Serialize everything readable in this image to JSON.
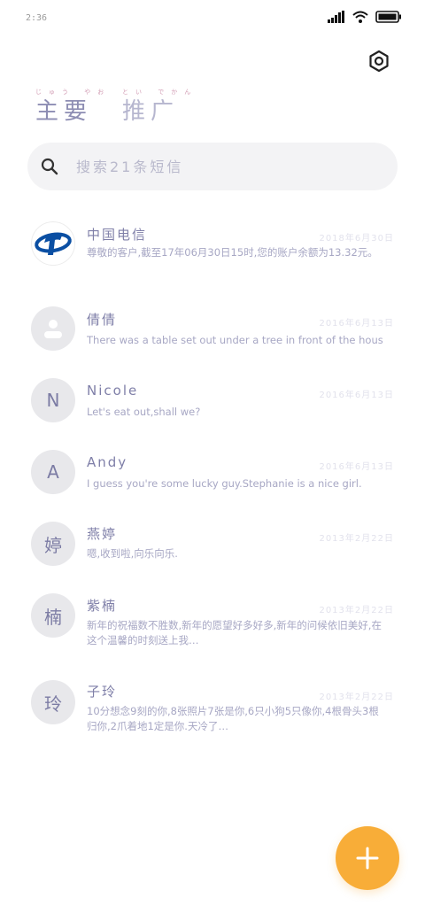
{
  "status_bar": {
    "time": "2:36"
  },
  "tabs": [
    {
      "label": "主要",
      "ruby": "じゅう やお"
    },
    {
      "label": "推广",
      "ruby": "とい でかん"
    }
  ],
  "search": {
    "placeholder": "搜索21条短信"
  },
  "conversations": [
    {
      "name": "中国电信",
      "avatar_text": "",
      "avatar_type": "brand",
      "date": "2018年6月30日",
      "snippet": "尊敬的客户,截至17年06月30日15时,您的账户余额为13.32元。"
    },
    {
      "name": "倩倩",
      "avatar_text": "",
      "avatar_type": "person",
      "date": "2016年6月13日",
      "snippet": "There was a table set out under a tree in front of the hous"
    },
    {
      "name": "Nicole",
      "avatar_text": "N",
      "avatar_type": "letter",
      "date": "2016年6月13日",
      "snippet": "Let's eat out,shall we?"
    },
    {
      "name": "Andy",
      "avatar_text": "A",
      "avatar_type": "letter",
      "date": "2016年6月13日",
      "snippet": "I guess you're some lucky guy.Stephanie is a nice girl."
    },
    {
      "name": "燕婷",
      "avatar_text": "婷",
      "avatar_type": "letter",
      "date": "2013年2月22日",
      "snippet": "嗯,收到啦,向乐向乐."
    },
    {
      "name": "紫楠",
      "avatar_text": "楠",
      "avatar_type": "letter",
      "date": "2013年2月22日",
      "snippet": "新年的祝福数不胜数,新年的愿望好多好多,新年的问候依旧美好,在这个温馨的时刻送上我…"
    },
    {
      "name": "子玲",
      "avatar_text": "玲",
      "avatar_type": "letter",
      "date": "2013年2月22日",
      "snippet": "10分想念9刻的你,8张照片7张是你,6只小狗5只像你,4根骨头3根归你,2爪着地1定是你.天冷了…"
    }
  ],
  "colors": {
    "accent": "#f8ad38",
    "brand_blue": "#0b4fa3"
  },
  "icons": {
    "settings": "hexagon-settings-icon",
    "search": "search-icon",
    "fab": "plus-icon"
  }
}
